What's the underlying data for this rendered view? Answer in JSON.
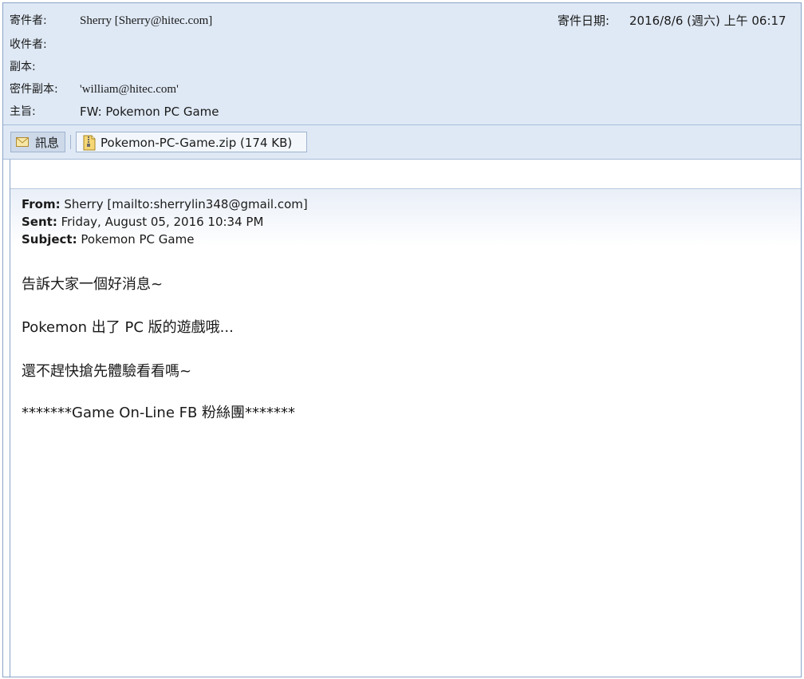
{
  "header": {
    "from_label": "寄件者:",
    "from_value": "Sherry [Sherry@hitec.com]",
    "to_label": "收件者:",
    "to_value": "",
    "cc_label": "副本:",
    "cc_value": "",
    "bcc_label": "密件副本:",
    "bcc_value": "'william@hitec.com'",
    "subject_label": "主旨:",
    "subject_value": "FW: Pokemon PC Game",
    "date_label": "寄件日期:",
    "date_value": "2016/8/6 (週六) 上午 06:17"
  },
  "tabs": {
    "message_label": "訊息",
    "attachment_label": "Pokemon-PC-Game.zip (174 KB)"
  },
  "forwarded": {
    "from_label": "From:",
    "from_value": " Sherry [mailto:sherrylin348@gmail.com]",
    "sent_label": "Sent:",
    "sent_value": " Friday, August 05, 2016 10:34 PM",
    "subject_label": "Subject:",
    "subject_value": " Pokemon PC Game"
  },
  "message": {
    "line1": "告訴大家一個好消息~",
    "line2": "Pokemon 出了 PC 版的遊戲哦...",
    "line3": "還不趕快搶先體驗看看嗎~",
    "line4": "*******Game On-Line FB 粉絲團*******"
  },
  "icons": {
    "message_tab_icon": "envelope-icon",
    "attachment_icon": "zip-file-icon"
  }
}
